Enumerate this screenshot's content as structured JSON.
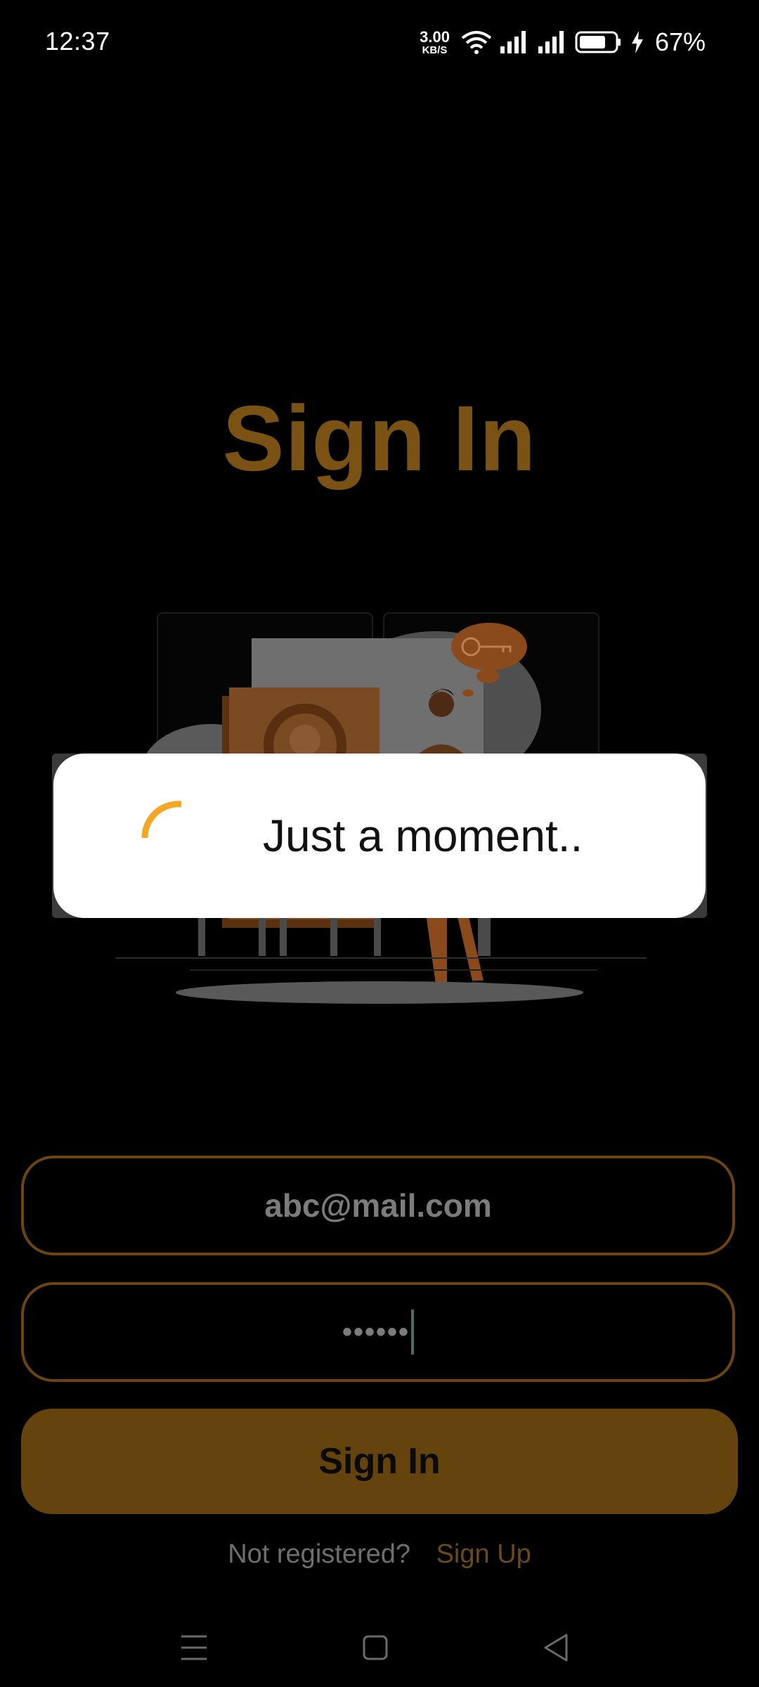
{
  "status_bar": {
    "time": "12:37",
    "net_speed_value": "3.00",
    "net_speed_unit": "KB/S",
    "battery_percent": "67%",
    "icons": [
      "wifi-icon",
      "signal-icon",
      "signal-icon",
      "battery-icon",
      "charging-icon"
    ]
  },
  "login": {
    "title": "Sign In",
    "email_value": "abc@mail.com",
    "password_mask": "••••••",
    "sign_in_label": "Sign In",
    "not_registered": "Not registered?",
    "sign_up_label": "Sign Up"
  },
  "dialog": {
    "message": "Just a moment.."
  },
  "nav_bar": {
    "icons": [
      "menu-icon",
      "home-icon",
      "back-icon"
    ]
  },
  "colors": {
    "accent": "#F5A623",
    "title_dimmed": "#7A5314",
    "button_dimmed": "#64430D",
    "background": "#000000"
  }
}
